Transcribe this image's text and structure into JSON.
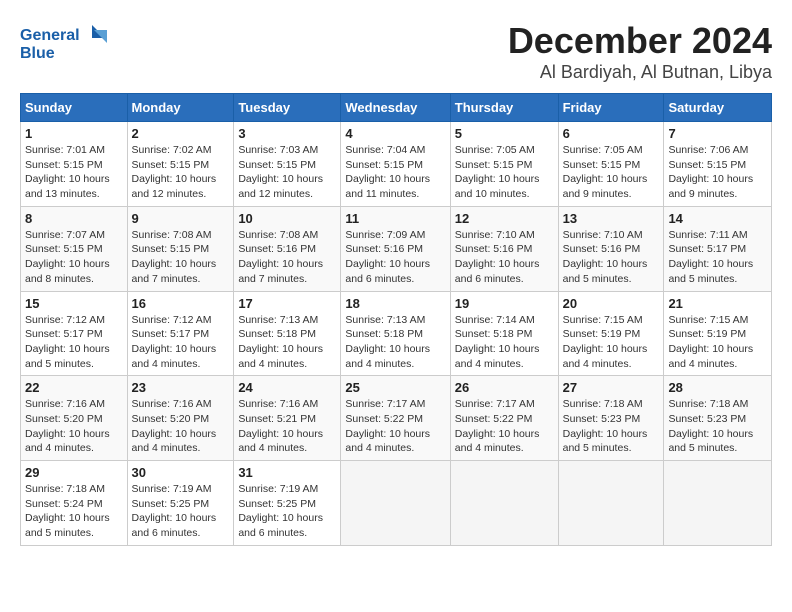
{
  "logo": {
    "text_general": "General",
    "text_blue": "Blue"
  },
  "header": {
    "month": "December 2024",
    "location": "Al Bardiyah, Al Butnan, Libya"
  },
  "days_of_week": [
    "Sunday",
    "Monday",
    "Tuesday",
    "Wednesday",
    "Thursday",
    "Friday",
    "Saturday"
  ],
  "weeks": [
    [
      {
        "day": "1",
        "sunrise": "7:01 AM",
        "sunset": "5:15 PM",
        "daylight": "10 hours and 13 minutes."
      },
      {
        "day": "2",
        "sunrise": "7:02 AM",
        "sunset": "5:15 PM",
        "daylight": "10 hours and 12 minutes."
      },
      {
        "day": "3",
        "sunrise": "7:03 AM",
        "sunset": "5:15 PM",
        "daylight": "10 hours and 12 minutes."
      },
      {
        "day": "4",
        "sunrise": "7:04 AM",
        "sunset": "5:15 PM",
        "daylight": "10 hours and 11 minutes."
      },
      {
        "day": "5",
        "sunrise": "7:05 AM",
        "sunset": "5:15 PM",
        "daylight": "10 hours and 10 minutes."
      },
      {
        "day": "6",
        "sunrise": "7:05 AM",
        "sunset": "5:15 PM",
        "daylight": "10 hours and 9 minutes."
      },
      {
        "day": "7",
        "sunrise": "7:06 AM",
        "sunset": "5:15 PM",
        "daylight": "10 hours and 9 minutes."
      }
    ],
    [
      {
        "day": "8",
        "sunrise": "7:07 AM",
        "sunset": "5:15 PM",
        "daylight": "10 hours and 8 minutes."
      },
      {
        "day": "9",
        "sunrise": "7:08 AM",
        "sunset": "5:15 PM",
        "daylight": "10 hours and 7 minutes."
      },
      {
        "day": "10",
        "sunrise": "7:08 AM",
        "sunset": "5:16 PM",
        "daylight": "10 hours and 7 minutes."
      },
      {
        "day": "11",
        "sunrise": "7:09 AM",
        "sunset": "5:16 PM",
        "daylight": "10 hours and 6 minutes."
      },
      {
        "day": "12",
        "sunrise": "7:10 AM",
        "sunset": "5:16 PM",
        "daylight": "10 hours and 6 minutes."
      },
      {
        "day": "13",
        "sunrise": "7:10 AM",
        "sunset": "5:16 PM",
        "daylight": "10 hours and 5 minutes."
      },
      {
        "day": "14",
        "sunrise": "7:11 AM",
        "sunset": "5:17 PM",
        "daylight": "10 hours and 5 minutes."
      }
    ],
    [
      {
        "day": "15",
        "sunrise": "7:12 AM",
        "sunset": "5:17 PM",
        "daylight": "10 hours and 5 minutes."
      },
      {
        "day": "16",
        "sunrise": "7:12 AM",
        "sunset": "5:17 PM",
        "daylight": "10 hours and 4 minutes."
      },
      {
        "day": "17",
        "sunrise": "7:13 AM",
        "sunset": "5:18 PM",
        "daylight": "10 hours and 4 minutes."
      },
      {
        "day": "18",
        "sunrise": "7:13 AM",
        "sunset": "5:18 PM",
        "daylight": "10 hours and 4 minutes."
      },
      {
        "day": "19",
        "sunrise": "7:14 AM",
        "sunset": "5:18 PM",
        "daylight": "10 hours and 4 minutes."
      },
      {
        "day": "20",
        "sunrise": "7:15 AM",
        "sunset": "5:19 PM",
        "daylight": "10 hours and 4 minutes."
      },
      {
        "day": "21",
        "sunrise": "7:15 AM",
        "sunset": "5:19 PM",
        "daylight": "10 hours and 4 minutes."
      }
    ],
    [
      {
        "day": "22",
        "sunrise": "7:16 AM",
        "sunset": "5:20 PM",
        "daylight": "10 hours and 4 minutes."
      },
      {
        "day": "23",
        "sunrise": "7:16 AM",
        "sunset": "5:20 PM",
        "daylight": "10 hours and 4 minutes."
      },
      {
        "day": "24",
        "sunrise": "7:16 AM",
        "sunset": "5:21 PM",
        "daylight": "10 hours and 4 minutes."
      },
      {
        "day": "25",
        "sunrise": "7:17 AM",
        "sunset": "5:22 PM",
        "daylight": "10 hours and 4 minutes."
      },
      {
        "day": "26",
        "sunrise": "7:17 AM",
        "sunset": "5:22 PM",
        "daylight": "10 hours and 4 minutes."
      },
      {
        "day": "27",
        "sunrise": "7:18 AM",
        "sunset": "5:23 PM",
        "daylight": "10 hours and 5 minutes."
      },
      {
        "day": "28",
        "sunrise": "7:18 AM",
        "sunset": "5:23 PM",
        "daylight": "10 hours and 5 minutes."
      }
    ],
    [
      {
        "day": "29",
        "sunrise": "7:18 AM",
        "sunset": "5:24 PM",
        "daylight": "10 hours and 5 minutes."
      },
      {
        "day": "30",
        "sunrise": "7:19 AM",
        "sunset": "5:25 PM",
        "daylight": "10 hours and 6 minutes."
      },
      {
        "day": "31",
        "sunrise": "7:19 AM",
        "sunset": "5:25 PM",
        "daylight": "10 hours and 6 minutes."
      },
      null,
      null,
      null,
      null
    ]
  ]
}
